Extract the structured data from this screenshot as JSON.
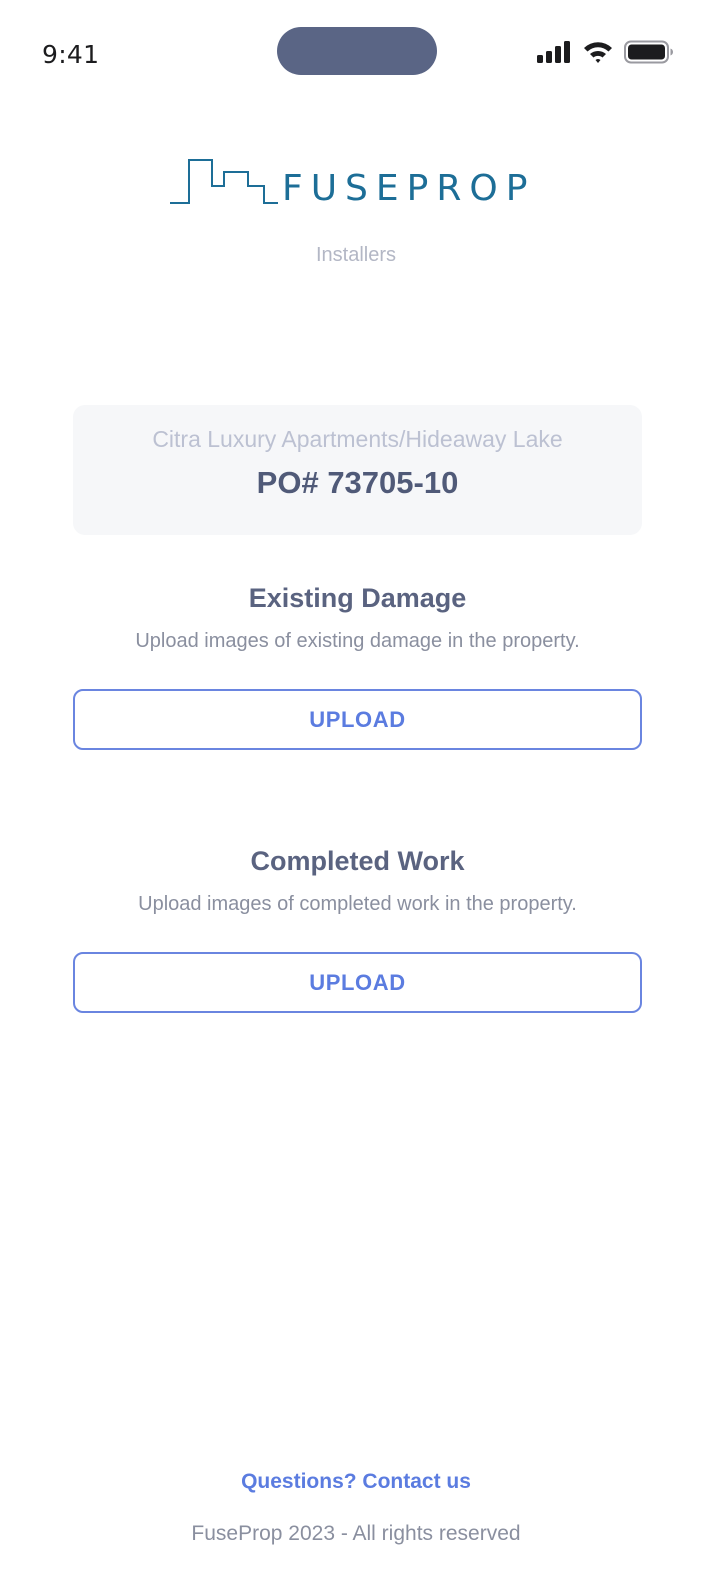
{
  "status_bar": {
    "time": "9:41",
    "icons": [
      "cellular-signal-icon",
      "wifi-icon",
      "battery-icon"
    ]
  },
  "header": {
    "logo_text": "FUSEPROP",
    "subtitle": "Installers"
  },
  "property": {
    "name": "Citra Luxury Apartments/Hideaway Lake",
    "po": "PO# 73705-10"
  },
  "sections": [
    {
      "title": "Existing Damage",
      "description": "Upload images of existing damage in the property.",
      "button_label": "UPLOAD"
    },
    {
      "title": "Completed Work",
      "description": "Upload images of completed work in the property.",
      "button_label": "UPLOAD"
    }
  ],
  "footer": {
    "contact_link": "Questions? Contact us",
    "copyright": "FuseProp 2023 - All rights reserved"
  },
  "colors": {
    "brand": "#1d6e97",
    "accent": "#5b7ce0",
    "heading": "#505a78",
    "muted": "#8a8f9f"
  }
}
